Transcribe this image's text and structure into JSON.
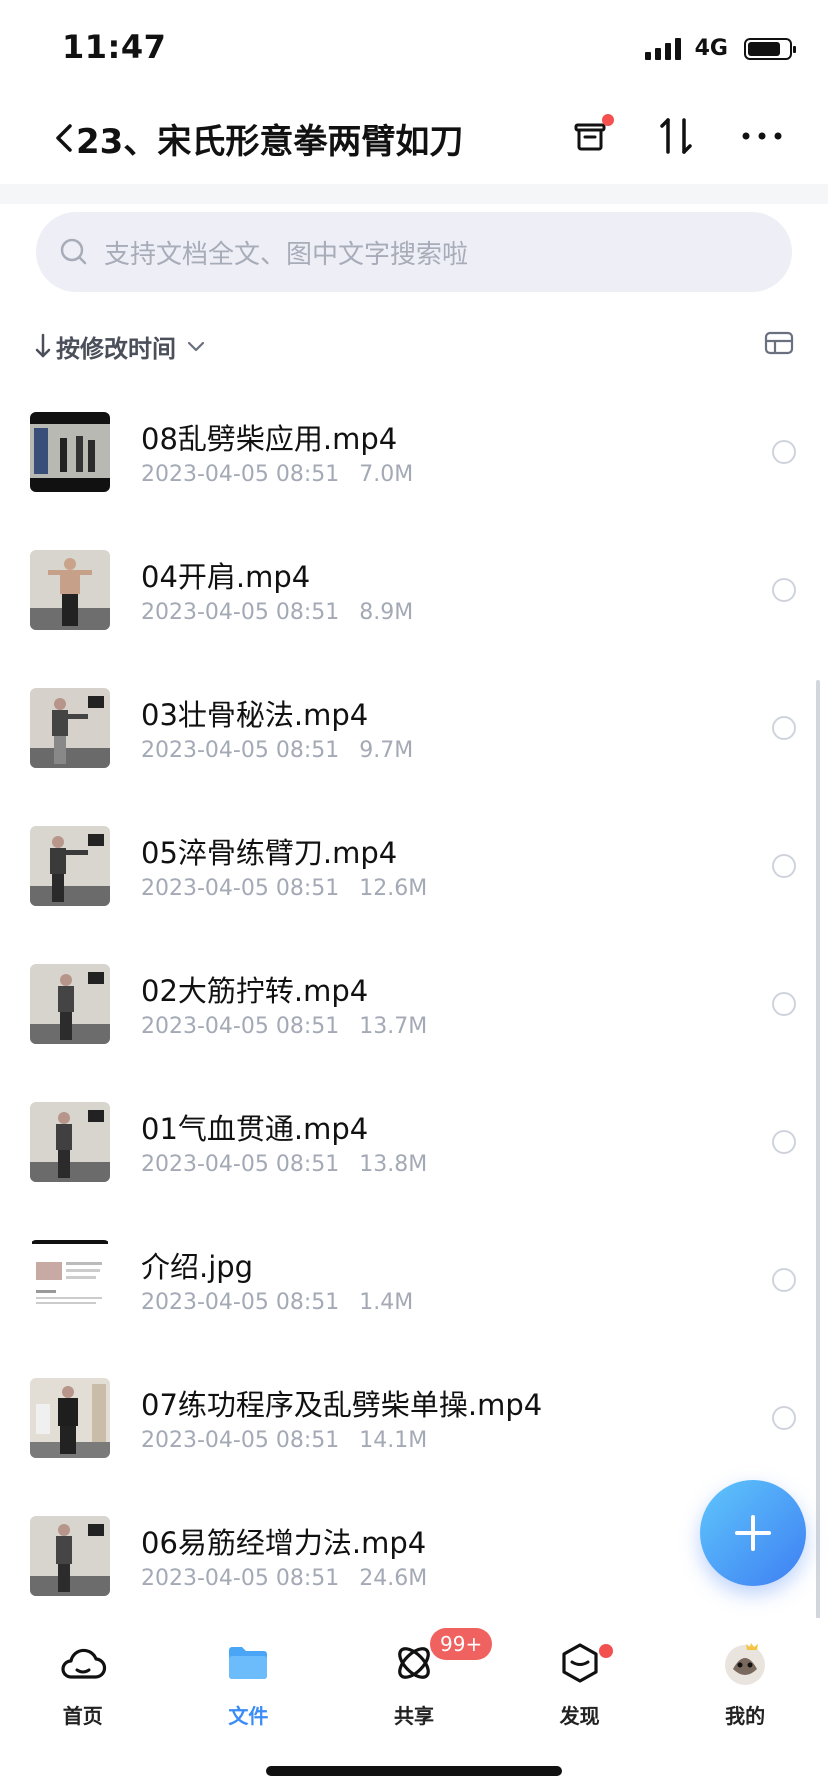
{
  "status_bar": {
    "time": "11:47",
    "network": "4G"
  },
  "header": {
    "title": "23、宋氏形意拳两臂如刀"
  },
  "search": {
    "placeholder": "支持文档全文、图中文字搜索啦"
  },
  "sort": {
    "label": "按修改时间"
  },
  "files": [
    {
      "name": "08乱劈柴应用.mp4",
      "date": "2023-04-05 08:51",
      "size": "7.0M",
      "thumb": "video-dark"
    },
    {
      "name": "04开肩.mp4",
      "date": "2023-04-05 08:51",
      "size": "8.9M",
      "thumb": "video-person"
    },
    {
      "name": "03壮骨秘法.mp4",
      "date": "2023-04-05 08:51",
      "size": "9.7M",
      "thumb": "video-person"
    },
    {
      "name": "05淬骨练臂刀.mp4",
      "date": "2023-04-05 08:51",
      "size": "12.6M",
      "thumb": "video-person"
    },
    {
      "name": "02大筋拧转.mp4",
      "date": "2023-04-05 08:51",
      "size": "13.7M",
      "thumb": "video-person"
    },
    {
      "name": "01气血贯通.mp4",
      "date": "2023-04-05 08:51",
      "size": "13.8M",
      "thumb": "video-person"
    },
    {
      "name": "介绍.jpg",
      "date": "2023-04-05 08:51",
      "size": "1.4M",
      "thumb": "image-doc"
    },
    {
      "name": "07练功程序及乱劈柴单操.mp4",
      "date": "2023-04-05 08:51",
      "size": "14.1M",
      "thumb": "video-person"
    },
    {
      "name": "06易筋经增力法.mp4",
      "date": "2023-04-05 08:51",
      "size": "24.6M",
      "thumb": "video-person"
    }
  ],
  "tabs": [
    {
      "label": "首页",
      "icon": "cloud-icon"
    },
    {
      "label": "文件",
      "icon": "folder-icon",
      "active": true
    },
    {
      "label": "共享",
      "icon": "share-icon"
    },
    {
      "label": "发现",
      "icon": "discover-icon"
    },
    {
      "label": "我的",
      "icon": "avatar-icon"
    }
  ],
  "share_badge": "99+",
  "colors": {
    "accent": "#3b8df5",
    "badge": "#f0625f",
    "fab": "#4d9cf7"
  }
}
